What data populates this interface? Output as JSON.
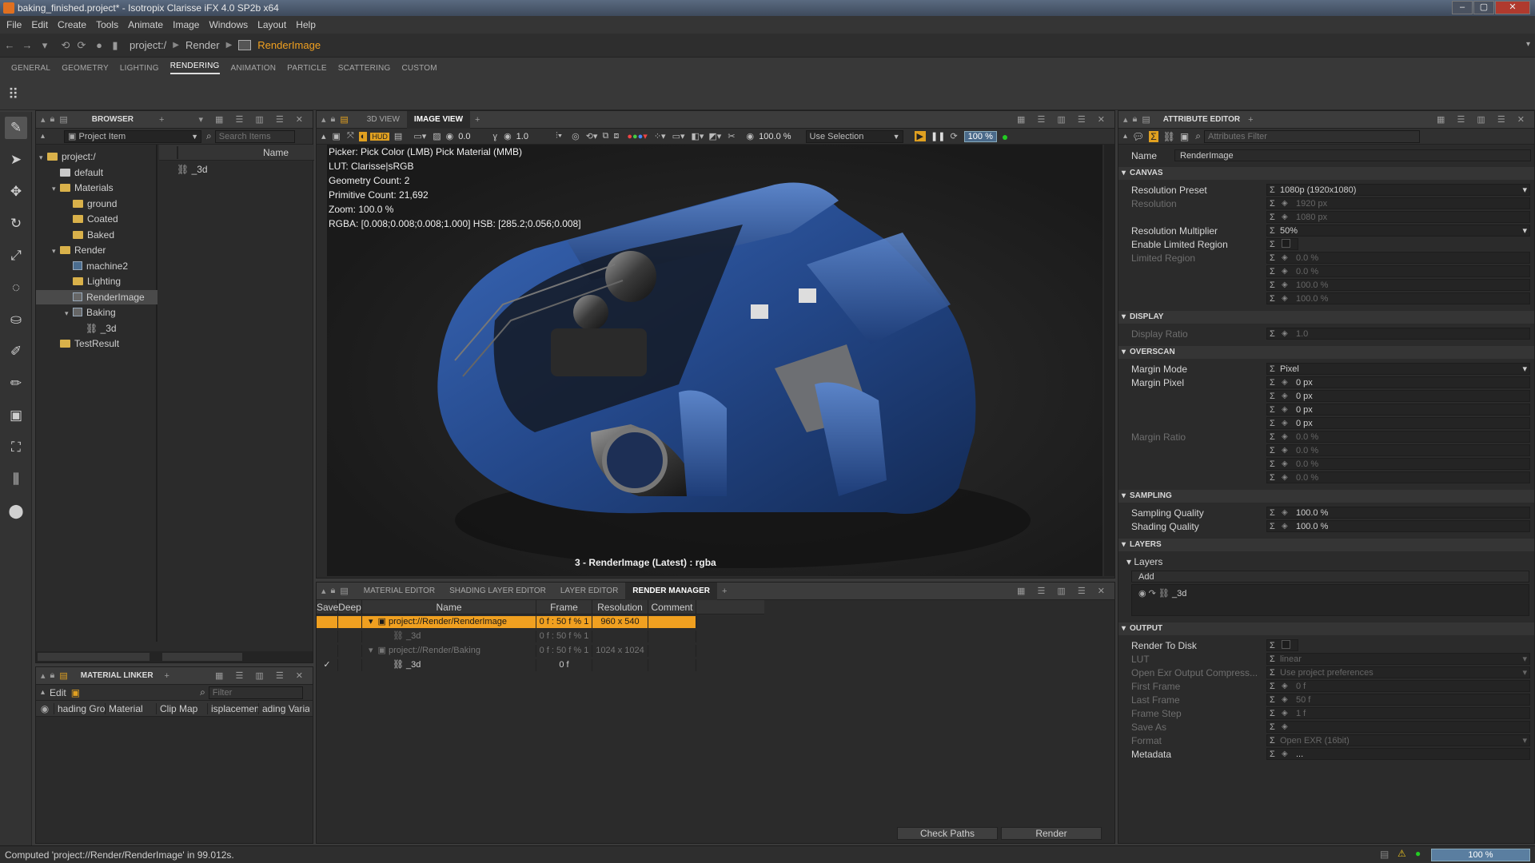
{
  "window": {
    "title": "baking_finished.project* - Isotropix Clarisse iFX 4.0 SP2b x64",
    "controls": [
      "–",
      "▢",
      "✕"
    ]
  },
  "menu": [
    "File",
    "Edit",
    "Create",
    "Tools",
    "Animate",
    "Image",
    "Windows",
    "Layout",
    "Help"
  ],
  "breadcrumb": {
    "root": "project:/",
    "mid": "Render",
    "current": "RenderImage"
  },
  "main_tabs": [
    {
      "label": "GENERAL"
    },
    {
      "label": "GEOMETRY"
    },
    {
      "label": "LIGHTING"
    },
    {
      "label": "RENDERING",
      "active": true
    },
    {
      "label": "ANIMATION"
    },
    {
      "label": "PARTICLE"
    },
    {
      "label": "SCATTERING"
    },
    {
      "label": "CUSTOM"
    }
  ],
  "browser": {
    "title": "BROWSER",
    "filter": "Project Item",
    "search_placeholder": "Search Items",
    "name_col": "Name",
    "selected_child": "_3d",
    "tree": [
      {
        "label": "project:/",
        "type": "folder",
        "depth": 0,
        "open": true
      },
      {
        "label": "default",
        "type": "ctx",
        "depth": 1
      },
      {
        "label": "Materials",
        "type": "folder",
        "depth": 1,
        "open": true
      },
      {
        "label": "ground",
        "type": "folder",
        "depth": 2
      },
      {
        "label": "Coated",
        "type": "folder",
        "depth": 2
      },
      {
        "label": "Baked",
        "type": "folder",
        "depth": 2
      },
      {
        "label": "Render",
        "type": "folder",
        "depth": 1,
        "open": true
      },
      {
        "label": "machine2",
        "type": "node",
        "depth": 2
      },
      {
        "label": "Lighting",
        "type": "folder",
        "depth": 2
      },
      {
        "label": "RenderImage",
        "type": "image",
        "depth": 2,
        "selected": true
      },
      {
        "label": "Baking",
        "type": "image",
        "depth": 2,
        "open": true
      },
      {
        "label": "_3d",
        "type": "layer",
        "depth": 3
      },
      {
        "label": "TestResult",
        "type": "folder",
        "depth": 1
      }
    ]
  },
  "material_linker": {
    "title": "MATERIAL LINKER",
    "edit_label": "Edit",
    "filter_placeholder": "Filter",
    "columns": [
      "hading Grou",
      "Material",
      "Clip Map",
      "isplacemen",
      "ading Varial"
    ]
  },
  "viewer": {
    "tabs": [
      {
        "label": "3D VIEW"
      },
      {
        "label": "IMAGE VIEW",
        "active": true
      }
    ],
    "toolbar": {
      "exposure": "0.0",
      "gamma": "1.0",
      "zoom": "100.0 %",
      "selection": "Use Selection",
      "progress": "100 %"
    },
    "info_lines": [
      "Picker: Pick Color (LMB)  Pick Material (MMB)",
      "LUT: Clarisse|sRGB",
      "Geometry Count: 2",
      "Primitive Count: 21,692",
      "Zoom: 100.0 %",
      "RGBA: [0.008;0.008;0.008;1.000] HSB: [285.2;0.056;0.008]"
    ],
    "caption": "3 - RenderImage (Latest) : rgba"
  },
  "bottom_panel": {
    "tabs": [
      {
        "label": "MATERIAL EDITOR"
      },
      {
        "label": "SHADING LAYER EDITOR"
      },
      {
        "label": "LAYER EDITOR"
      },
      {
        "label": "RENDER MANAGER",
        "active": true
      }
    ],
    "columns": [
      "Save",
      "Deep",
      "Name",
      "Frame Range",
      "Resolution",
      "Comment"
    ],
    "rows": [
      {
        "name": "project://Render/RenderImage",
        "frame": "0 f : 50 f % 1",
        "res": "960 x 540",
        "highlight": true,
        "indent": 0,
        "expand": "▾"
      },
      {
        "name": "_3d",
        "frame": "0 f : 50 f % 1",
        "res": "",
        "dim": true,
        "indent": 1
      },
      {
        "name": "project://Render/Baking",
        "frame": "0 f : 50 f % 1",
        "res": "1024 x 1024",
        "dim": true,
        "indent": 0,
        "expand": "▾"
      },
      {
        "name": "_3d",
        "frame": "0 f",
        "res": "",
        "save": "✓",
        "indent": 1
      }
    ],
    "buttons": {
      "check": "Check Paths",
      "render": "Render"
    }
  },
  "attribute_editor": {
    "title": "ATTRIBUTE EDITOR",
    "filter_placeholder": "Attributes Filter",
    "name_label": "Name",
    "name_value": "RenderImage",
    "sections": [
      {
        "title": "CANVAS",
        "attrs": [
          {
            "label": "Resolution Preset",
            "values": [
              "1080p (1920x1080)"
            ],
            "combo": true
          },
          {
            "label": "Resolution",
            "values": [
              "1920 px",
              "1080 px"
            ],
            "dim": true
          },
          {
            "label": "Resolution Multiplier",
            "values": [
              "50%"
            ],
            "combo": true
          },
          {
            "label": "Enable Limited Region",
            "values": [
              ""
            ],
            "check": true
          },
          {
            "label": "Limited Region",
            "values": [
              "0.0 %",
              "0.0 %",
              "100.0 %",
              "100.0 %"
            ],
            "dim": true
          }
        ]
      },
      {
        "title": "DISPLAY",
        "attrs": [
          {
            "label": "Display Ratio",
            "values": [
              "1.0"
            ],
            "dim": true
          }
        ]
      },
      {
        "title": "OVERSCAN",
        "attrs": [
          {
            "label": "Margin Mode",
            "values": [
              "Pixel"
            ],
            "combo": true
          },
          {
            "label": "Margin Pixel",
            "values": [
              "0 px",
              "0 px",
              "0 px",
              "0 px"
            ]
          },
          {
            "label": "Margin Ratio",
            "values": [
              "0.0 %",
              "0.0 %",
              "0.0 %",
              "0.0 %"
            ],
            "dim": true
          }
        ]
      },
      {
        "title": "SAMPLING",
        "attrs": [
          {
            "label": "Sampling Quality",
            "values": [
              "100.0 %"
            ]
          },
          {
            "label": "Shading Quality",
            "values": [
              "100.0 %"
            ]
          }
        ]
      },
      {
        "title": "LAYERS",
        "layers": {
          "label": "Layers",
          "add": "Add",
          "item": "_3d"
        }
      },
      {
        "title": "OUTPUT",
        "attrs": [
          {
            "label": "Render To Disk",
            "values": [
              ""
            ],
            "check": true
          },
          {
            "label": "LUT",
            "values": [
              "linear"
            ],
            "dim": true,
            "combo": true
          },
          {
            "label": "Open Exr Output Compress...",
            "values": [
              "Use project preferences"
            ],
            "dim": true,
            "combo": true
          },
          {
            "label": "First Frame",
            "values": [
              "0 f"
            ],
            "dim": true
          },
          {
            "label": "Last Frame",
            "values": [
              "50 f"
            ],
            "dim": true
          },
          {
            "label": "Frame Step",
            "values": [
              "1 f"
            ],
            "dim": true
          },
          {
            "label": "Save As",
            "values": [
              ""
            ],
            "dim": true
          },
          {
            "label": "Format",
            "values": [
              "Open EXR (16bit)"
            ],
            "dim": true,
            "combo": true
          },
          {
            "label": "Metadata",
            "values": [
              "..."
            ]
          }
        ]
      }
    ]
  },
  "status": {
    "message": "Computed 'project://Render/RenderImage' in 99.012s.",
    "progress": "100 %"
  },
  "colors": {
    "accent": "#f0a020",
    "panel": "#2b2b2b",
    "header": "#3c3c3c",
    "model_blue": "#2a54a0",
    "status_green": "#22cc22",
    "warn_yellow": "#e8c020"
  }
}
